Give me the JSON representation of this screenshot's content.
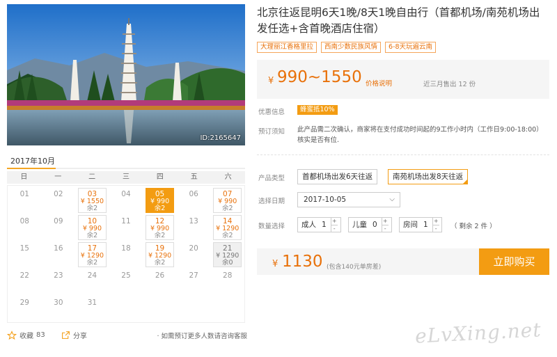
{
  "photo": {
    "id_label": "ID:2165647"
  },
  "title": "北京往返昆明6天1晚/8天1晚自由行（首都机场/南苑机场出发任选+含首晚酒店住宿）",
  "tags": [
    "大理丽江香格里拉",
    "西南少数民族风情",
    "6-8天玩遍云南"
  ],
  "price": {
    "currency": "¥",
    "range": "990~1550",
    "note": "价格说明",
    "sold": "近三月售出 12 份"
  },
  "promo": {
    "label": "优惠信息",
    "badge": "蜂蜜抵10%"
  },
  "notice": {
    "label": "预订须知",
    "text": "此产品需二次确认，商家将在支付成功时间起的9工作小时内（工作日9:00-18:00）核实是否有位."
  },
  "product_type": {
    "label": "产品类型",
    "options": [
      "首都机场出发6天往返",
      "南苑机场出发8天往返"
    ],
    "selected_index": 1
  },
  "date": {
    "label": "选择日期",
    "value": "2017-10-05"
  },
  "quantity": {
    "label": "数量选择",
    "adult": {
      "label": "成人",
      "value": "1"
    },
    "child": {
      "label": "儿童",
      "value": "0"
    },
    "room": {
      "label": "房间",
      "value": "1"
    },
    "remain": "（ 剩余 2 件 ）"
  },
  "total": {
    "currency": "¥",
    "value": "1130",
    "included": "(包含140元单房差)"
  },
  "buy_label": "立即购买",
  "calendar": {
    "month": "2017年10月",
    "weekdays": [
      "日",
      "一",
      "二",
      "三",
      "四",
      "五",
      "六"
    ],
    "days": [
      {
        "d": "01"
      },
      {
        "d": "02"
      },
      {
        "d": "03",
        "p": "¥ 1550",
        "r": "余2"
      },
      {
        "d": "04"
      },
      {
        "d": "05",
        "p": "¥ 990",
        "r": "余2",
        "sel": true
      },
      {
        "d": "06"
      },
      {
        "d": "07",
        "p": "¥ 990",
        "r": "余2"
      },
      {
        "d": "08"
      },
      {
        "d": "09"
      },
      {
        "d": "10",
        "p": "¥ 990",
        "r": "余2"
      },
      {
        "d": "11"
      },
      {
        "d": "12",
        "p": "¥ 990",
        "r": "余2"
      },
      {
        "d": "13"
      },
      {
        "d": "14",
        "p": "¥ 1290",
        "r": "余2"
      },
      {
        "d": "15"
      },
      {
        "d": "16"
      },
      {
        "d": "17",
        "p": "¥ 1290",
        "r": "余2"
      },
      {
        "d": "18"
      },
      {
        "d": "19",
        "p": "¥ 1290",
        "r": "余2"
      },
      {
        "d": "20"
      },
      {
        "d": "21",
        "p": "¥ 1290",
        "r": "余0",
        "sold": true
      },
      {
        "d": "22"
      },
      {
        "d": "23"
      },
      {
        "d": "24"
      },
      {
        "d": "25"
      },
      {
        "d": "26"
      },
      {
        "d": "27"
      },
      {
        "d": "28"
      },
      {
        "d": "29"
      },
      {
        "d": "30"
      },
      {
        "d": "31"
      },
      {
        "d": ""
      },
      {
        "d": ""
      },
      {
        "d": ""
      },
      {
        "d": ""
      }
    ]
  },
  "footer": {
    "favorite_label": "收藏",
    "favorite_count": "83",
    "share_label": "分享",
    "consult": "· 如需预订更多人数请咨询客服"
  },
  "watermark": "eLvXing.net",
  "colors": {
    "accent": "#f39c12",
    "price": "#e8710a"
  }
}
